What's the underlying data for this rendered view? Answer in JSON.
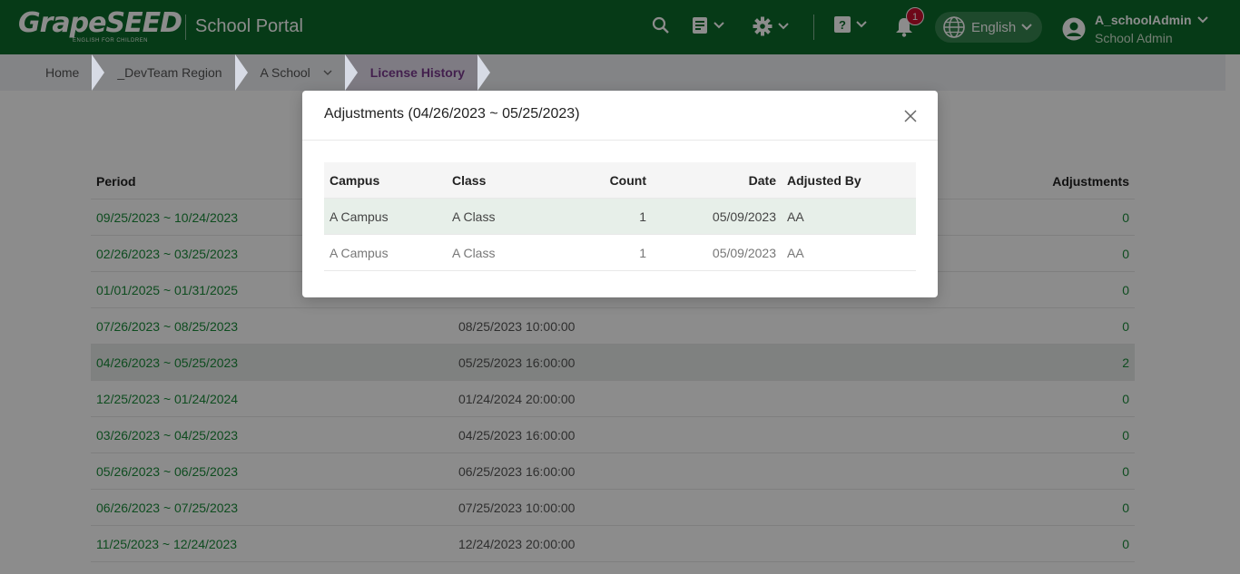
{
  "header": {
    "brand": "GrapeSEED",
    "brand_sub": "ENGLISH FOR CHILDREN",
    "portal_title": "School Portal",
    "notification_count": "1",
    "language": "English",
    "user_name": "A_schoolAdmin",
    "user_role": "School Admin",
    "icons": [
      "search-icon",
      "document-icon",
      "gear-icon",
      "help-icon",
      "bell-icon",
      "globe-icon",
      "user-avatar-icon"
    ],
    "colors": {
      "bar": "#0c6b2a",
      "badge": "#c8102e"
    }
  },
  "breadcrumb": [
    {
      "label": "Home"
    },
    {
      "label": "_DevTeam Region"
    },
    {
      "label": "A School"
    },
    {
      "label": "License History"
    }
  ],
  "main_table": {
    "columns": {
      "period": "Period",
      "adjustments": "Adjustments"
    },
    "rows": [
      {
        "period": "09/25/2023 ~ 10/24/2023",
        "date": "",
        "adjustments": "0"
      },
      {
        "period": "02/26/2023 ~ 03/25/2023",
        "date": "",
        "adjustments": "0"
      },
      {
        "period": "01/01/2025 ~ 01/31/2025",
        "date": "",
        "adjustments": "0"
      },
      {
        "period": "07/26/2023 ~ 08/25/2023",
        "date": "08/25/2023 10:00:00",
        "adjustments": "0"
      },
      {
        "period": "04/26/2023 ~ 05/25/2023",
        "date": "05/25/2023 16:00:00",
        "adjustments": "2"
      },
      {
        "period": "12/25/2023 ~ 01/24/2024",
        "date": "01/24/2024 20:00:00",
        "adjustments": "0"
      },
      {
        "period": "03/26/2023 ~ 04/25/2023",
        "date": "04/25/2023 16:00:00",
        "adjustments": "0"
      },
      {
        "period": "05/26/2023 ~ 06/25/2023",
        "date": "06/25/2023 16:00:00",
        "adjustments": "0"
      },
      {
        "period": "06/26/2023 ~ 07/25/2023",
        "date": "07/25/2023 10:00:00",
        "adjustments": "0"
      },
      {
        "period": "11/25/2023 ~ 12/24/2023",
        "date": "12/24/2023 20:00:00",
        "adjustments": "0"
      }
    ]
  },
  "modal": {
    "title": "Adjustments (04/26/2023 ~ 05/25/2023)",
    "columns": {
      "campus": "Campus",
      "class": "Class",
      "count": "Count",
      "date": "Date",
      "adjusted_by": "Adjusted By"
    },
    "rows": [
      {
        "campus": "A Campus",
        "class": "A Class",
        "count": "1",
        "date": "05/09/2023",
        "adjusted_by": "AA"
      },
      {
        "campus": "A Campus",
        "class": "A Class",
        "count": "1",
        "date": "05/09/2023",
        "adjusted_by": "AA"
      }
    ]
  }
}
